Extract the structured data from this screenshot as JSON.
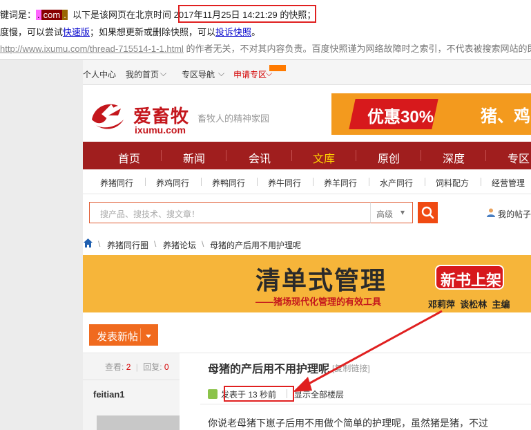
{
  "snapshot": {
    "line1_prefix": "键词是：",
    "kw_a": ".",
    "kw_b": "com",
    "kw_c": ".",
    "line1_mid": "  以下是该网页在北京时间 ",
    "line1_time": "2017年11月25日 14:21:29 的快照；",
    "line2_prefix": "度慢，可以尝试",
    "fast_link": "快速版",
    "line2_mid": "；如果想更新或删除快照，可以",
    "complain_link": "投诉快照",
    "line2_end": "。",
    "url": "http://www.ixumu.com/thread-715514-1-1.html",
    "line3_text": " 的作者无关，不对其内容负责。百度快照谨为网络故障时之索引，不代表被搜索网站的即"
  },
  "topnav": {
    "personal": "个人中心",
    "home": "我的首页",
    "home_caret": "⌵",
    "zone": "专区导航",
    "zone_caret": "⌵",
    "apply": "申请专区",
    "apply_caret": "⌵"
  },
  "logo": {
    "cn": "爱畜牧",
    "en": "ixumu.com",
    "slogan": "畜牧人的精神家园"
  },
  "promo": {
    "text": "优惠30%",
    "text2": "猪、鸡"
  },
  "mainnav": [
    "首页",
    "新闻",
    "会讯",
    "文库",
    "原创",
    "深度",
    "专区"
  ],
  "subnav": [
    "养猪同行",
    "养鸡同行",
    "养鸭同行",
    "养牛同行",
    "养羊同行",
    "水产同行",
    "饲料配方",
    "经营管理"
  ],
  "search": {
    "placeholder": "搜产品、搜技术、搜文章！",
    "select": "高级",
    "select_caret": "▾"
  },
  "mypost": "我的帖子",
  "breadcrumb": {
    "sep": "\\",
    "items": [
      "养猪同行圈",
      "养猪论坛",
      "母猪的产后用不用护理呢"
    ]
  },
  "banner": {
    "title": "清单式管理",
    "subtitle": "——猪场现代化管理的有效工具",
    "badge": "新书上架",
    "authors": "邓莉萍  谈松林  主编"
  },
  "post": {
    "new_post_button": "发表新帖",
    "views_label": "查看:",
    "views": "2",
    "sep": "|",
    "replies_label": "回复:",
    "replies": "0",
    "username": "feitian1",
    "title": "母猪的产后用不用护理呢",
    "copy_link": "[复制链接]",
    "posted_time": "发表于 13 秒前",
    "show_all": "显示全部楼层",
    "body_start": "你说老母猪下崽子后用不用做个简单的护理呢，虽然猪是猪，不过"
  },
  "colors": {
    "brand_red": "#a01e1e",
    "accent_orange": "#f06a1e",
    "annotation_red": "#e02020"
  }
}
